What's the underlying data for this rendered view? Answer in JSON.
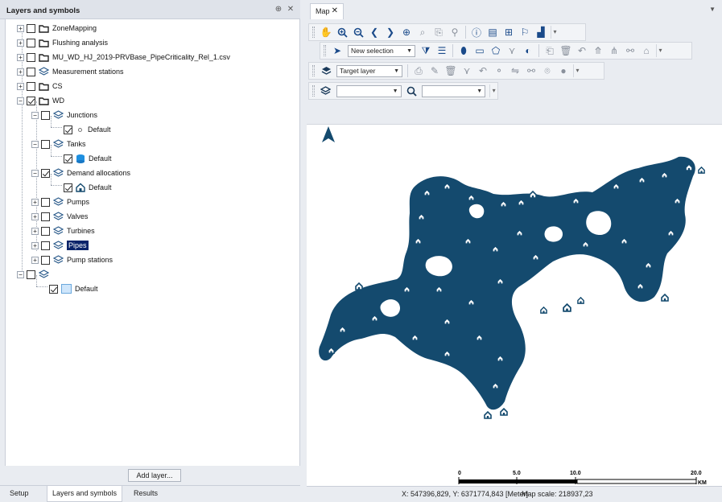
{
  "left_panel": {
    "title": "Layers and symbols",
    "pin_glyph": "⊕",
    "close_glyph": "✕",
    "tree": [
      {
        "label": "ZoneMapping"
      },
      {
        "label": "Flushing analysis"
      },
      {
        "label": "MU_WD_HJ_2019-PRVBase_PipeCriticality_Rel_1.csv"
      },
      {
        "label": "Measurement stations"
      },
      {
        "label": "CS"
      },
      {
        "label": "WD"
      },
      {
        "label": "Junctions"
      },
      {
        "label": "Default"
      },
      {
        "label": "Tanks"
      },
      {
        "label": "Default"
      },
      {
        "label": "Demand allocations"
      },
      {
        "label": "Default"
      },
      {
        "label": "Pumps"
      },
      {
        "label": "Valves"
      },
      {
        "label": "Turbines"
      },
      {
        "label": "Pipes"
      },
      {
        "label": "Pump stations"
      },
      {
        "label": ""
      },
      {
        "label": "Default"
      }
    ],
    "add_layer_label": "Add layer...",
    "tabs": [
      "Setup",
      "Layers and symbols",
      "Results"
    ]
  },
  "map": {
    "tab_label": "Map",
    "tab_close": "✕",
    "selection_combo": "New selection",
    "target_combo": "Target layer",
    "layer_combo": "",
    "search_combo": "",
    "north_arrow": "▲",
    "scale_labels": [
      "0",
      "5.0",
      "10.0",
      "20.0"
    ],
    "scale_unit": "KM",
    "accent_color": "#144a6e"
  },
  "status": {
    "coordinates": "X: 547396,829, Y: 6371774,843 [Meter]",
    "map_scale": "Map scale: 218937,23"
  }
}
